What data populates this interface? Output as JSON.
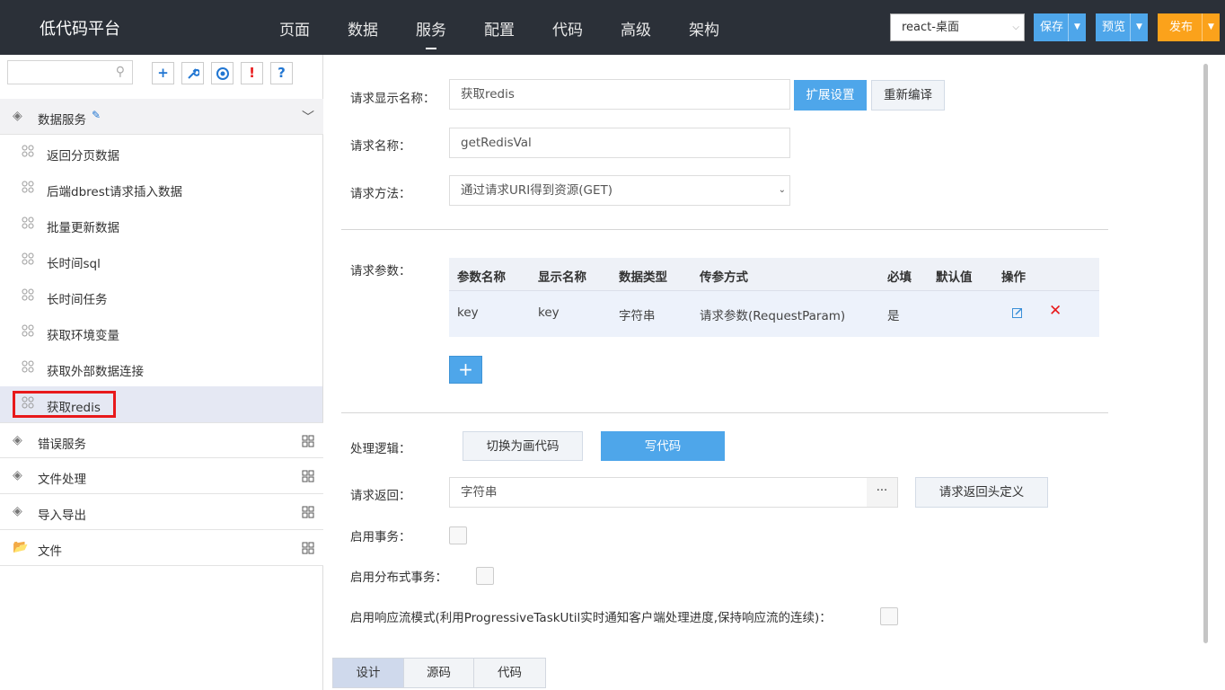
{
  "app": {
    "title": "低代码平台"
  },
  "nav": {
    "items": [
      "页面",
      "数据",
      "服务",
      "配置",
      "代码",
      "高级",
      "架构"
    ],
    "active": "服务"
  },
  "project_select": {
    "value": "react-桌面"
  },
  "actions": {
    "save": "保存",
    "preview": "预览",
    "publish": "发布"
  },
  "sidebar": {
    "search_placeholder": "",
    "tools": [
      "+",
      "🔧",
      "◎",
      "!",
      "?"
    ],
    "group_open": {
      "label": "数据服务"
    },
    "items": [
      "返回分页数据",
      "后端dbrest请求插入数据",
      "批量更新数据",
      "长时间sql",
      "长时间任务",
      "获取环境变量",
      "获取外部数据连接",
      "获取redis"
    ],
    "selected_item": "获取redis",
    "groups": [
      "错误服务",
      "文件处理",
      "导入导出",
      "文件"
    ]
  },
  "form": {
    "display_name_label": "请求显示名称：",
    "display_name_value": "获取redis",
    "ext_settings_btn": "扩展设置",
    "recompile_btn": "重新编译",
    "name_label": "请求名称：",
    "name_value": "getRedisVal",
    "method_label": "请求方法：",
    "method_value": "通过请求URI得到资源(GET)",
    "params_label": "请求参数：",
    "params_headers": [
      "参数名称",
      "显示名称",
      "数据类型",
      "传参方式",
      "必填",
      "默认值",
      "操作"
    ],
    "params_rows": [
      {
        "name": "key",
        "display": "key",
        "type": "字符串",
        "mode": "请求参数(RequestParam)",
        "required": "是",
        "default": ""
      }
    ],
    "add_param_btn": "+",
    "logic_label": "处理逻辑：",
    "switch_visual_btn": "切换为画代码",
    "write_code_btn": "写代码",
    "return_label": "请求返回：",
    "return_value": "字符串",
    "return_more_btn": "···",
    "return_header_btn": "请求返回头定义",
    "tx_label": "启用事务：",
    "dist_tx_label": "启用分布式事务：",
    "stream_label": "启用响应流模式(利用ProgressiveTaskUtil实时通知客户端处理进度,保持响应流的连续)："
  },
  "bottom_tabs": [
    "设计",
    "源码",
    "代码"
  ],
  "bottom_tabs_active": "设计"
}
